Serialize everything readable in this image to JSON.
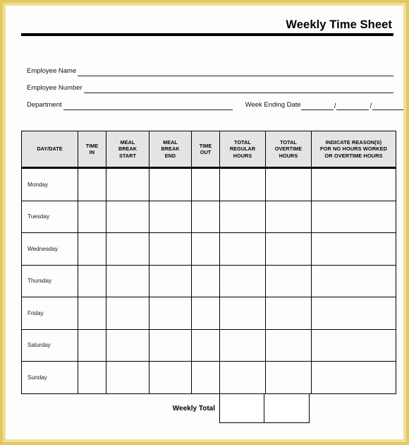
{
  "document": {
    "title": "Weekly Time Sheet"
  },
  "fields": {
    "employee_name_label": "Employee Name",
    "employee_name_value": "",
    "employee_number_label": "Employee Number",
    "employee_number_value": "",
    "department_label": "Department",
    "department_value": "",
    "week_ending_label": "Week Ending Date",
    "week_ending_month": "",
    "week_ending_day": "",
    "week_ending_year": "",
    "date_separator": "/"
  },
  "table": {
    "headers": [
      "DAY/DATE",
      "TIME\nIN",
      "MEAL\nBREAK\nSTART",
      "MEAL\nBREAK\nEND",
      "TIME\nOUT",
      "TOTAL\nREGULAR\nHOURS",
      "TOTAL\nOVERTIME\nHOURS",
      "INDICATE REASON(S)\nFOR NO HOURS WORKED\nOR OVERTIME HOURS"
    ],
    "headers_flat": {
      "day_date": "DAY/DATE",
      "time_in_l1": "TIME",
      "time_in_l2": "IN",
      "meal_start_l1": "MEAL",
      "meal_start_l2": "BREAK",
      "meal_start_l3": "START",
      "meal_end_l1": "MEAL",
      "meal_end_l2": "BREAK",
      "meal_end_l3": "END",
      "time_out_l1": "TIME",
      "time_out_l2": "OUT",
      "total_regular_l1": "TOTAL",
      "total_regular_l2": "REGULAR",
      "total_regular_l3": "HOURS",
      "total_overtime_l1": "TOTAL",
      "total_overtime_l2": "OVERTIME",
      "total_overtime_l3": "HOURS",
      "reason_l1": "INDICATE REASON(S)",
      "reason_l2": "FOR NO HOURS WORKED",
      "reason_l3": "OR OVERTIME HOURS"
    },
    "rows": [
      {
        "day": "Monday",
        "time_in": "",
        "meal_break_start": "",
        "meal_break_end": "",
        "time_out": "",
        "total_regular_hours": "",
        "total_overtime_hours": "",
        "reason": ""
      },
      {
        "day": "Tuesday",
        "time_in": "",
        "meal_break_start": "",
        "meal_break_end": "",
        "time_out": "",
        "total_regular_hours": "",
        "total_overtime_hours": "",
        "reason": ""
      },
      {
        "day": "Wednesday",
        "time_in": "",
        "meal_break_start": "",
        "meal_break_end": "",
        "time_out": "",
        "total_regular_hours": "",
        "total_overtime_hours": "",
        "reason": ""
      },
      {
        "day": "Thursday",
        "time_in": "",
        "meal_break_start": "",
        "meal_break_end": "",
        "time_out": "",
        "total_regular_hours": "",
        "total_overtime_hours": "",
        "reason": ""
      },
      {
        "day": "Friday",
        "time_in": "",
        "meal_break_start": "",
        "meal_break_end": "",
        "time_out": "",
        "total_regular_hours": "",
        "total_overtime_hours": "",
        "reason": ""
      },
      {
        "day": "Saturday",
        "time_in": "",
        "meal_break_start": "",
        "meal_break_end": "",
        "time_out": "",
        "total_regular_hours": "",
        "total_overtime_hours": "",
        "reason": ""
      },
      {
        "day": "Sunday",
        "time_in": "",
        "meal_break_start": "",
        "meal_break_end": "",
        "time_out": "",
        "total_regular_hours": "",
        "total_overtime_hours": "",
        "reason": ""
      }
    ]
  },
  "footer": {
    "weekly_total_label": "Weekly Total",
    "weekly_total_regular": "",
    "weekly_total_overtime": "",
    "watermark": ""
  },
  "colors": {
    "frame_outer": "#e3c85c",
    "frame_inner": "#f0de9a",
    "sheet_background": "#fdfdfb",
    "header_fill": "#e4e4e4",
    "rule": "#000000",
    "text": "#000000"
  }
}
